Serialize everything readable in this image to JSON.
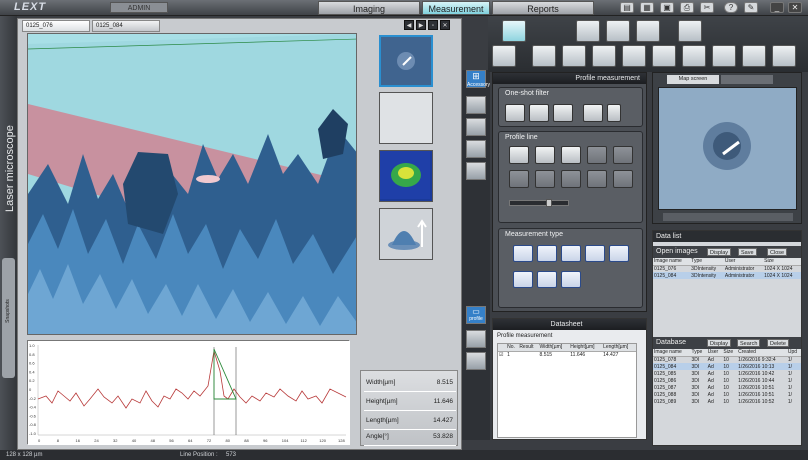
{
  "app": {
    "logo": "LEXT",
    "user": "ADMIN",
    "vertical_title": "Laser microscope",
    "side_tab": "Snapshots"
  },
  "top_tabs": [
    {
      "label": "Imaging",
      "active": false
    },
    {
      "label": "Measurement",
      "active": true
    },
    {
      "label": "Reports",
      "active": false
    }
  ],
  "image_tabs": [
    "0125_076",
    "0125_084"
  ],
  "profile_chart": {
    "y_ticks": [
      "1.0",
      "0.8",
      "0.6",
      "0.4",
      "0.2",
      "0",
      "-0.2",
      "-0.4",
      "-0.6",
      "-0.8",
      "-1.0"
    ],
    "x_ticks": [
      "0",
      "8",
      "16",
      "24",
      "32",
      "40",
      "48",
      "56",
      "64",
      "72",
      "80",
      "88",
      "96",
      "104",
      "112",
      "120",
      "128"
    ]
  },
  "measurements": [
    {
      "label": "Width[µm]",
      "value": "8.515"
    },
    {
      "label": "Height[µm]",
      "value": "11.646"
    },
    {
      "label": "Length[µm]",
      "value": "14.427"
    },
    {
      "label": "Angle[°]",
      "value": "53.828"
    }
  ],
  "profile_panel": {
    "header": "Profile measurement",
    "one_shot_filter": "One-shot filter",
    "profile_line": "Profile line",
    "measurement_type": "Measurement type"
  },
  "side_strip": {
    "accessory": "Accessory",
    "profile": "profile"
  },
  "datasheet": {
    "header": "Datasheet",
    "table_title": "Profile measurement",
    "columns": [
      "No.",
      "Result",
      "Width[µm]",
      "Height[µm]",
      "Length[µm]"
    ],
    "rows": [
      [
        "1",
        "",
        "8.515",
        "11.646",
        "14.427"
      ]
    ]
  },
  "preview": {
    "tab1": "Map screen",
    "tab2": ""
  },
  "data_list": {
    "header": "Data list",
    "open_images": {
      "title": "Open images",
      "buttons": [
        "Display",
        "Save",
        "Close"
      ],
      "columns": [
        "Image name",
        "Type",
        "User",
        "Size"
      ],
      "rows": [
        [
          "0125_076",
          "3DIntensity",
          "Administrator",
          "1024 X 1024"
        ],
        [
          "0125_084",
          "3DIntensity",
          "Administrator",
          "1024 X 1024"
        ]
      ]
    },
    "database": {
      "title": "Database",
      "buttons": [
        "Display",
        "Search",
        "Delete"
      ],
      "columns": [
        "Image name",
        "Type",
        "User",
        "Size",
        "Created",
        "Upd"
      ],
      "rows": [
        [
          "0125_078",
          "3DI",
          "Ad",
          "10",
          "1/26/2016 9:32:4",
          "1/"
        ],
        [
          "0125_084",
          "3DI",
          "Ad",
          "10",
          "1/26/2016 10:13",
          "1/"
        ],
        [
          "0125_085",
          "3DI",
          "Ad",
          "10",
          "1/26/2016 10:42",
          "1/"
        ],
        [
          "0125_086",
          "3DI",
          "Ad",
          "10",
          "1/26/2016 10:44",
          "1/"
        ],
        [
          "0125_087",
          "3DI",
          "Ad",
          "10",
          "1/26/2016 10:51",
          "1/"
        ],
        [
          "0125_088",
          "3DI",
          "Ad",
          "10",
          "1/26/2016 10:51",
          "1/"
        ],
        [
          "0125_089",
          "3DI",
          "Ad",
          "10",
          "1/26/2016 10:52",
          "1/"
        ]
      ]
    }
  },
  "status": {
    "left": "128 x 128 µm",
    "mid_label": "Line Position :",
    "mid_value": "573"
  }
}
